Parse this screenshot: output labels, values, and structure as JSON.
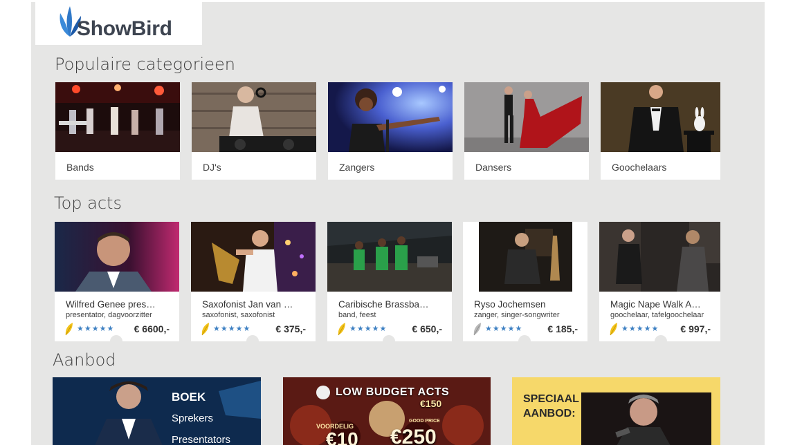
{
  "brand": {
    "name": "ShowBird",
    "accent": "#3b8ad9",
    "accent_dark": "#1d5aa8"
  },
  "sections": {
    "categories_title": "Populaire categorieen",
    "top_acts_title": "Top acts",
    "offers_title": "Aanbod"
  },
  "categories": [
    {
      "label": "Bands"
    },
    {
      "label": "DJ's"
    },
    {
      "label": "Zangers"
    },
    {
      "label": "Dansers"
    },
    {
      "label": "Goochelaars"
    }
  ],
  "top_acts": [
    {
      "name": "Wilfred Genee pres…",
      "tags": "presentator, dagvoorzitter",
      "stars": "★★★★★",
      "price": "€ 6600,-",
      "feather_color": "#f2c21b"
    },
    {
      "name": "Saxofonist Jan van …",
      "tags": "saxofonist, saxofonist",
      "stars": "★★★★★",
      "price": "€ 375,-",
      "feather_color": "#f2c21b"
    },
    {
      "name": "Caribische Brassba…",
      "tags": "band, feest",
      "stars": "★★★★★",
      "price": "€ 650,-",
      "feather_color": "#f2c21b"
    },
    {
      "name": "Ryso Jochemsen",
      "tags": "zanger, singer-songwriter",
      "stars": "★★★★★",
      "price": "€ 185,-",
      "feather_color": "#b8b8b8"
    },
    {
      "name": "Magic Nape Walk A…",
      "tags": "goochelaar, tafelgoochelaar",
      "stars": "★★★★★",
      "price": "€ 997,-",
      "feather_color": "#f2c21b"
    }
  ],
  "offers": [
    {
      "heading": "BOEK",
      "line1": "Sprekers",
      "line2": "Presentators"
    },
    {
      "heading": "LOW BUDGET ACTS",
      "badge_left": "€10",
      "badge_right": "€250",
      "small_left": "VOORDELIG",
      "small_right": "GOOD PRICE",
      "corner": "€150"
    },
    {
      "heading_line1": "SPECIAAL",
      "heading_line2": "AANBOD:"
    }
  ]
}
